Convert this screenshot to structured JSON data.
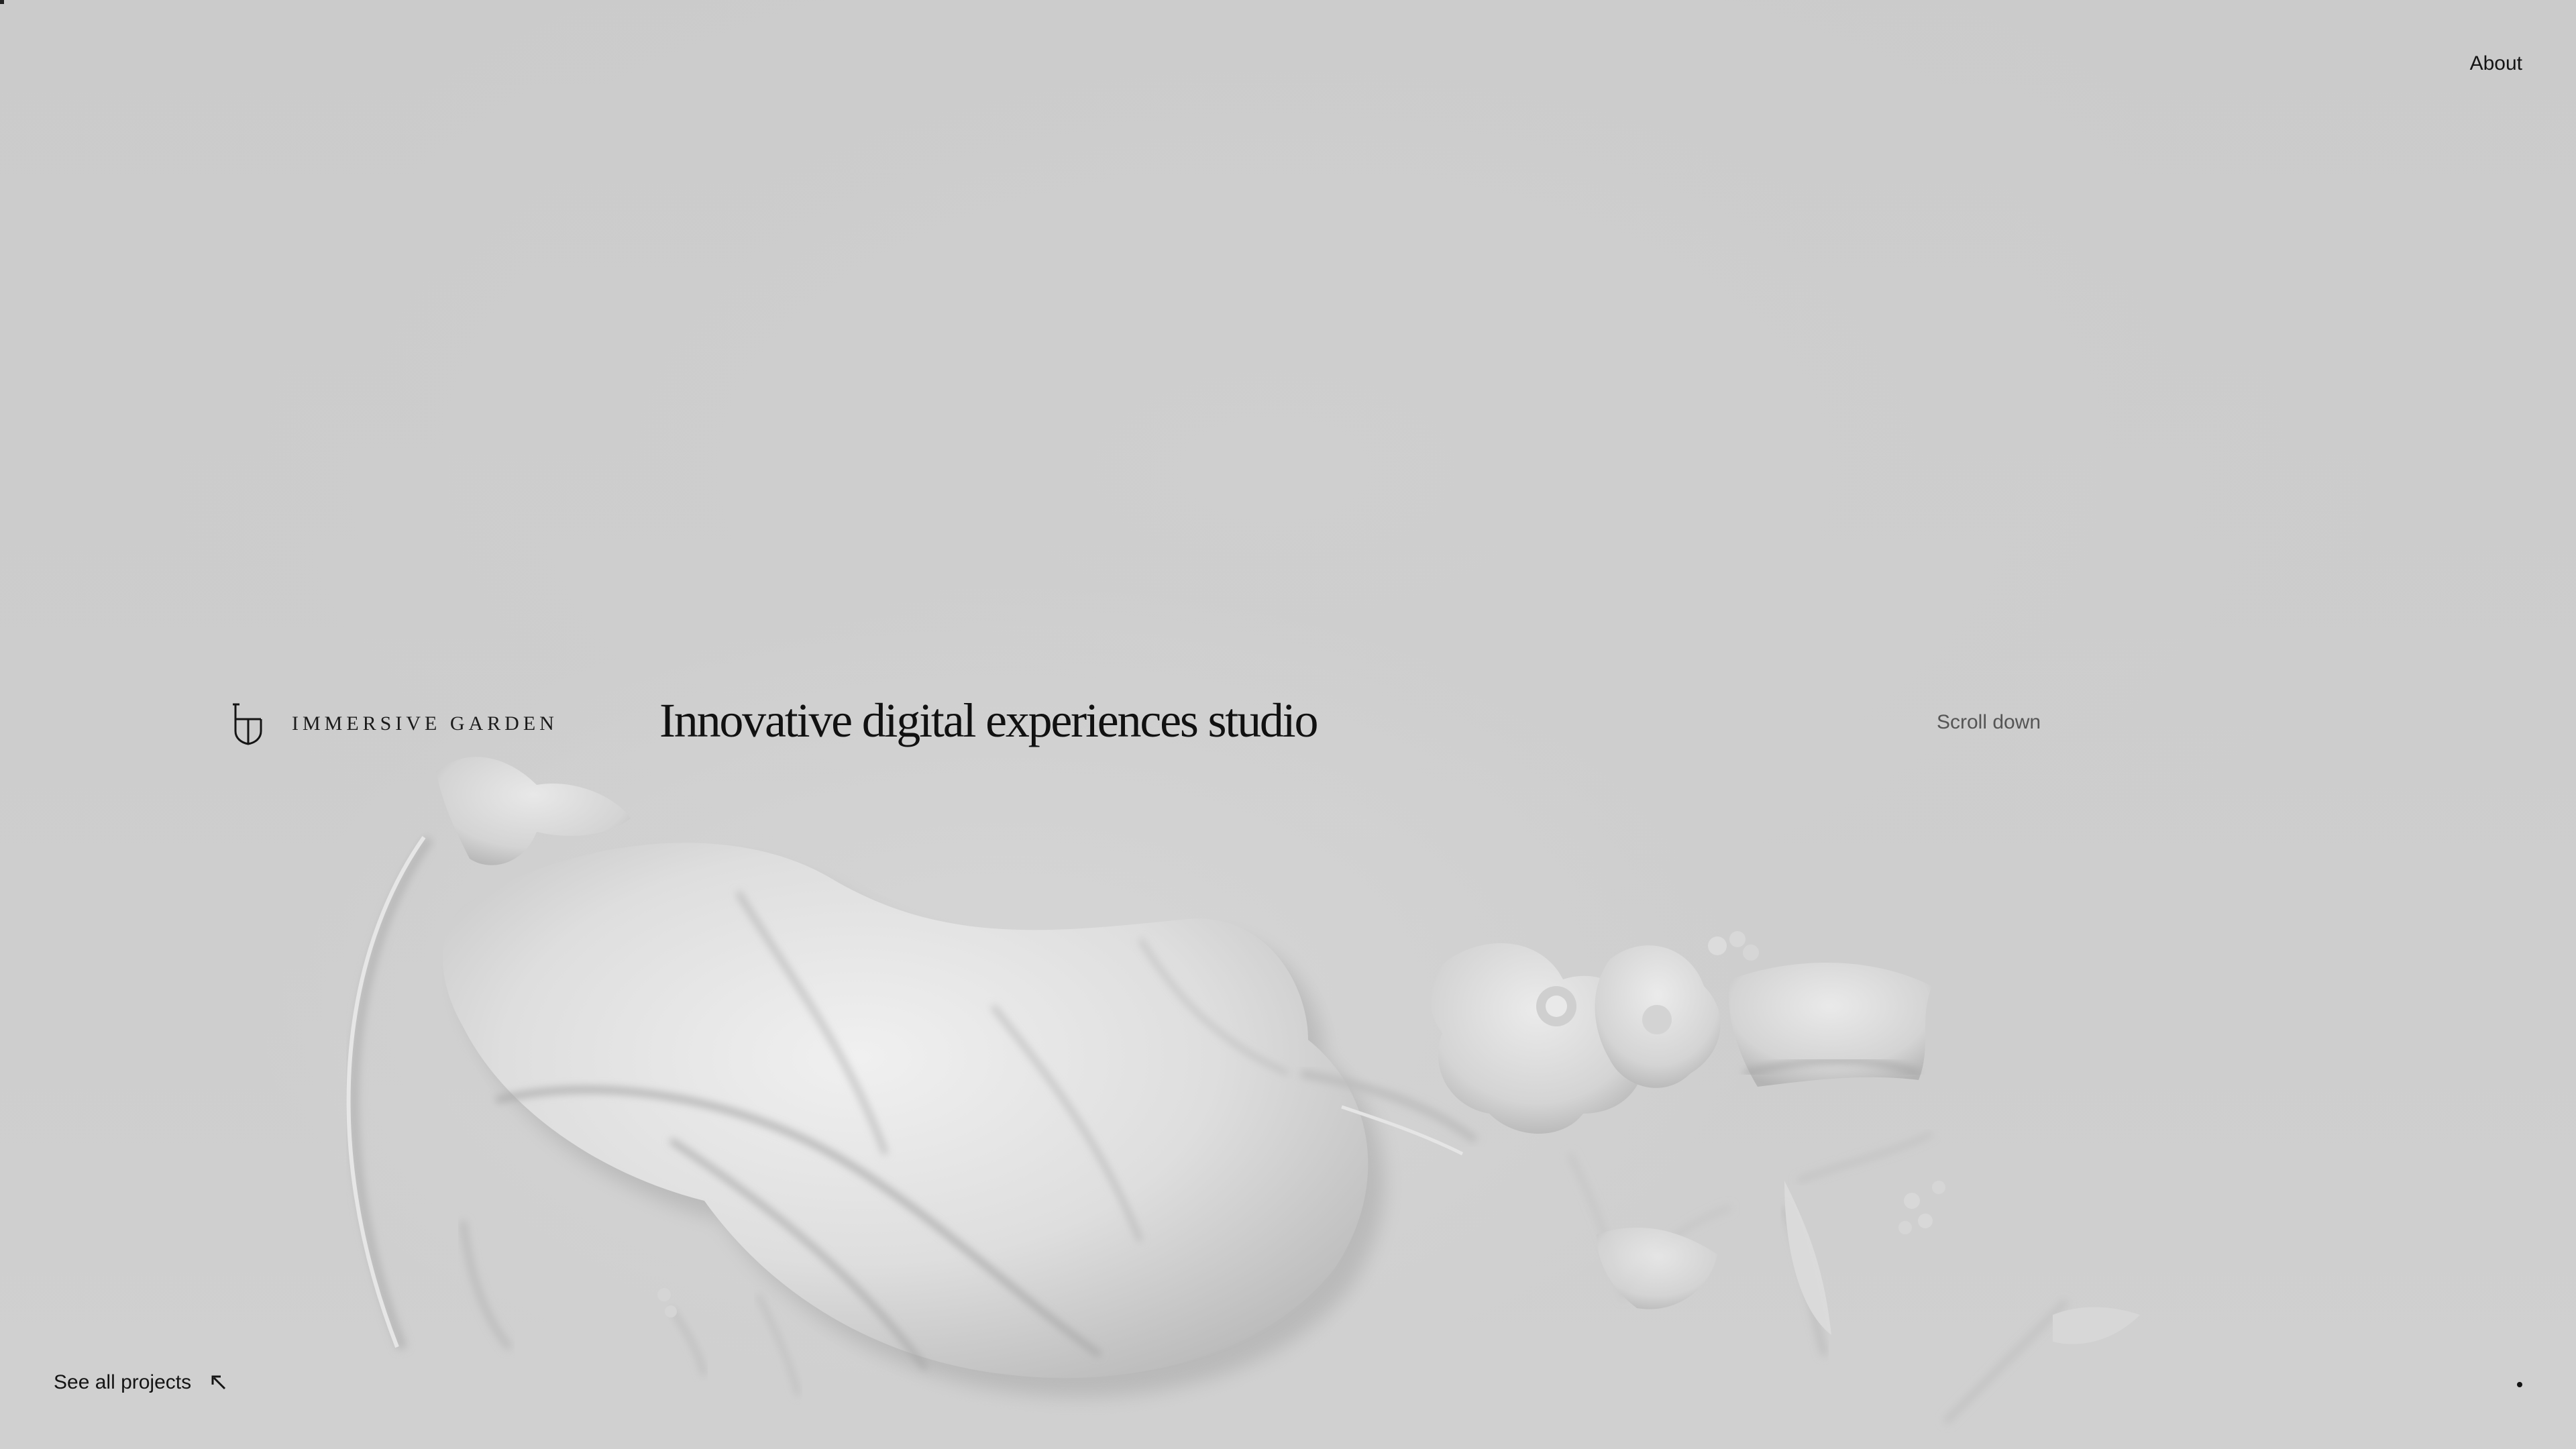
{
  "nav": {
    "about_label": "About"
  },
  "brand": {
    "name": "IMMERSIVE GARDEN",
    "logo_icon": "shield-monogram-icon"
  },
  "hero": {
    "headline": "Innovative digital experiences studio",
    "scroll_hint": "Scroll down"
  },
  "footer": {
    "projects_label": "See all projects",
    "projects_icon": "arrow-down-left-icon"
  },
  "colors": {
    "background": "#cdcdcd",
    "text": "#141414",
    "muted_text": "#555555"
  }
}
